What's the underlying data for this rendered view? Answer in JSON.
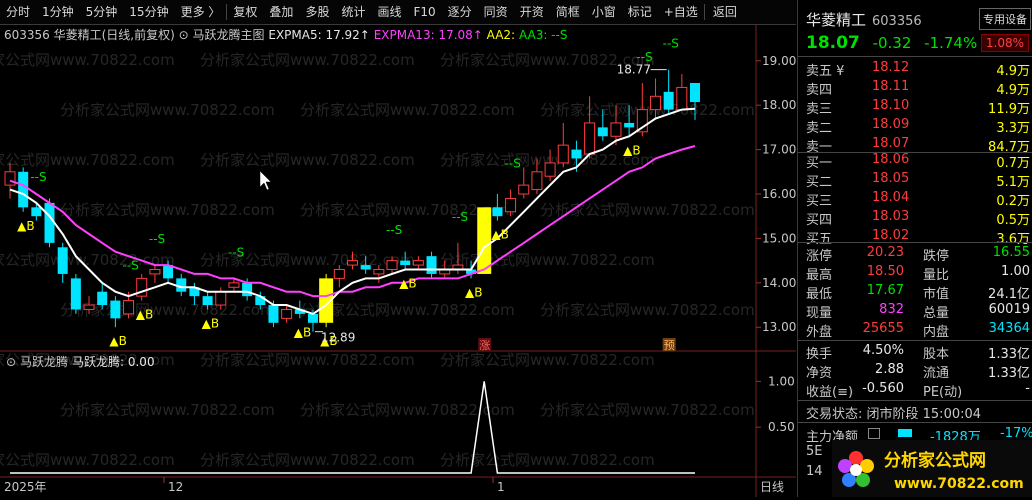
{
  "toolbar": {
    "items": [
      "分时",
      "1分钟",
      "5分钟",
      "15分钟",
      "更多 〉",
      "复权",
      "叠加",
      "多股",
      "统计",
      "画线",
      "F10",
      "逐分",
      "同资",
      "开资",
      "简框",
      "小窗",
      "标记",
      "+自选",
      "返回"
    ]
  },
  "main_chart": {
    "title": "603356 华菱精工(日线,前复权)",
    "indicator_name": "马跃龙腾主图",
    "expma5_label": "EXPMA5: 17.92↑",
    "expma13_label": "EXPMA13: 17.08↑",
    "aa2_label": "AA2:",
    "aa3_label": "AA3: --S",
    "y_axis_labels": [
      "19.00",
      "18.00",
      "17.00",
      "16.00",
      "15.00",
      "14.00",
      "13.00"
    ],
    "high_label": "18.77",
    "low_label": "12.89",
    "b_marker": "▲B",
    "s_marker": "--S",
    "event_zhang": "涨",
    "event_yu": "预",
    "x_axis_labels": [
      "2025年",
      "12",
      "1",
      "日线"
    ],
    "watermark": "分析家公式网www.70822.com",
    "colors": {
      "up": "#ff3c3c",
      "down": "#00e5ff",
      "expma5": "#ffffff",
      "expma13": "#ff40ff",
      "signal": "#ffff00",
      "sell": "#00e000"
    }
  },
  "sub_chart": {
    "title": "马跃龙腾",
    "value_label": "马跃龙腾: 0.00",
    "y_axis_labels": [
      "1.00",
      "0.50"
    ]
  },
  "chart_data": {
    "type": "candlestick",
    "ylim": [
      12.6,
      19.4
    ],
    "candles": [
      {
        "o": 16.2,
        "c": 16.5,
        "h": 16.7,
        "l": 15.9
      },
      {
        "o": 16.5,
        "c": 15.7,
        "h": 16.6,
        "l": 15.6
      },
      {
        "o": 15.7,
        "c": 15.5,
        "h": 15.8,
        "l": 15.4
      },
      {
        "o": 15.8,
        "c": 14.9,
        "h": 15.9,
        "l": 14.8
      },
      {
        "o": 14.8,
        "c": 14.2,
        "h": 14.9,
        "l": 14.0
      },
      {
        "o": 14.1,
        "c": 13.4,
        "h": 14.2,
        "l": 13.3
      },
      {
        "o": 13.4,
        "c": 13.5,
        "h": 13.7,
        "l": 13.3
      },
      {
        "o": 13.8,
        "c": 13.5,
        "h": 14.0,
        "l": 13.4
      },
      {
        "o": 13.6,
        "c": 13.2,
        "h": 13.7,
        "l": 13.0
      },
      {
        "o": 13.3,
        "c": 13.6,
        "h": 13.8,
        "l": 13.2
      },
      {
        "o": 13.7,
        "c": 14.1,
        "h": 14.2,
        "l": 13.6
      },
      {
        "o": 14.2,
        "c": 14.3,
        "h": 14.4,
        "l": 14.0
      },
      {
        "o": 14.4,
        "c": 14.1,
        "h": 14.5,
        "l": 14.0
      },
      {
        "o": 14.1,
        "c": 13.8,
        "h": 14.2,
        "l": 13.7
      },
      {
        "o": 13.9,
        "c": 13.7,
        "h": 14.0,
        "l": 13.5
      },
      {
        "o": 13.7,
        "c": 13.5,
        "h": 13.8,
        "l": 13.4
      },
      {
        "o": 13.5,
        "c": 13.8,
        "h": 13.9,
        "l": 13.4
      },
      {
        "o": 13.9,
        "c": 14.0,
        "h": 14.1,
        "l": 13.8
      },
      {
        "o": 14.0,
        "c": 13.7,
        "h": 14.1,
        "l": 13.6
      },
      {
        "o": 13.7,
        "c": 13.5,
        "h": 13.8,
        "l": 13.4
      },
      {
        "o": 13.5,
        "c": 13.1,
        "h": 13.6,
        "l": 13.0
      },
      {
        "o": 13.2,
        "c": 13.4,
        "h": 13.5,
        "l": 13.1
      },
      {
        "o": 13.4,
        "c": 13.3,
        "h": 13.6,
        "l": 13.2
      },
      {
        "o": 13.3,
        "c": 13.1,
        "h": 13.4,
        "l": 12.9
      },
      {
        "o": 13.1,
        "c": 14.1,
        "h": 14.2,
        "l": 13.0
      },
      {
        "o": 14.1,
        "c": 14.3,
        "h": 14.4,
        "l": 13.9
      },
      {
        "o": 14.4,
        "c": 14.5,
        "h": 14.7,
        "l": 14.3
      },
      {
        "o": 14.4,
        "c": 14.3,
        "h": 14.6,
        "l": 14.2
      },
      {
        "o": 14.2,
        "c": 14.3,
        "h": 14.4,
        "l": 14.0
      },
      {
        "o": 14.3,
        "c": 14.5,
        "h": 14.6,
        "l": 14.2
      },
      {
        "o": 14.5,
        "c": 14.4,
        "h": 14.7,
        "l": 14.3
      },
      {
        "o": 14.4,
        "c": 14.5,
        "h": 14.6,
        "l": 14.3
      },
      {
        "o": 14.6,
        "c": 14.2,
        "h": 14.7,
        "l": 14.1
      },
      {
        "o": 14.2,
        "c": 14.3,
        "h": 14.5,
        "l": 14.1
      },
      {
        "o": 14.3,
        "c": 14.4,
        "h": 14.9,
        "l": 14.2
      },
      {
        "o": 14.3,
        "c": 14.2,
        "h": 14.5,
        "l": 14.1
      },
      {
        "o": 14.2,
        "c": 15.7,
        "h": 15.7,
        "l": 14.2
      },
      {
        "o": 15.7,
        "c": 15.5,
        "h": 16.0,
        "l": 15.4
      },
      {
        "o": 15.6,
        "c": 15.9,
        "h": 16.1,
        "l": 15.5
      },
      {
        "o": 16.0,
        "c": 16.2,
        "h": 16.6,
        "l": 15.9
      },
      {
        "o": 16.1,
        "c": 16.5,
        "h": 16.8,
        "l": 16.0
      },
      {
        "o": 16.4,
        "c": 16.7,
        "h": 17.0,
        "l": 16.3
      },
      {
        "o": 16.7,
        "c": 17.1,
        "h": 17.6,
        "l": 16.6
      },
      {
        "o": 17.0,
        "c": 16.8,
        "h": 17.2,
        "l": 16.5
      },
      {
        "o": 16.9,
        "c": 17.6,
        "h": 18.2,
        "l": 16.8
      },
      {
        "o": 17.5,
        "c": 17.3,
        "h": 17.9,
        "l": 17.2
      },
      {
        "o": 17.3,
        "c": 17.6,
        "h": 18.0,
        "l": 17.1
      },
      {
        "o": 17.6,
        "c": 17.5,
        "h": 18.0,
        "l": 17.3
      },
      {
        "o": 17.4,
        "c": 17.9,
        "h": 18.5,
        "l": 17.3
      },
      {
        "o": 17.9,
        "c": 18.2,
        "h": 18.6,
        "l": 17.7
      },
      {
        "o": 18.3,
        "c": 17.9,
        "h": 18.8,
        "l": 17.8
      },
      {
        "o": 17.9,
        "c": 18.4,
        "h": 18.7,
        "l": 17.9
      },
      {
        "o": 18.5,
        "c": 18.07,
        "h": 18.5,
        "l": 17.67
      }
    ],
    "limit_up_indices": [
      24,
      36
    ],
    "expma5": [
      16.1,
      16.0,
      15.8,
      15.5,
      15.1,
      14.6,
      14.3,
      14.0,
      13.8,
      13.7,
      13.8,
      13.9,
      14.0,
      13.9,
      13.9,
      13.8,
      13.8,
      13.8,
      13.8,
      13.7,
      13.5,
      13.5,
      13.4,
      13.3,
      13.5,
      13.8,
      14.0,
      14.1,
      14.1,
      14.2,
      14.3,
      14.3,
      14.3,
      14.3,
      14.3,
      14.3,
      14.8,
      15.0,
      15.3,
      15.6,
      15.9,
      16.2,
      16.5,
      16.6,
      16.9,
      17.0,
      17.2,
      17.3,
      17.5,
      17.7,
      17.8,
      17.9,
      17.92
    ],
    "expma13": [
      16.3,
      16.2,
      16.0,
      15.8,
      15.6,
      15.3,
      15.1,
      14.9,
      14.7,
      14.6,
      14.5,
      14.4,
      14.4,
      14.3,
      14.2,
      14.2,
      14.1,
      14.1,
      14.0,
      14.0,
      13.9,
      13.8,
      13.8,
      13.7,
      13.7,
      13.8,
      13.8,
      13.9,
      13.9,
      14.0,
      14.0,
      14.1,
      14.1,
      14.1,
      14.1,
      14.2,
      14.3,
      14.5,
      14.7,
      14.9,
      15.1,
      15.3,
      15.5,
      15.7,
      15.9,
      16.1,
      16.3,
      16.5,
      16.6,
      16.8,
      16.9,
      17.0,
      17.08
    ],
    "buy_indices": [
      1,
      8,
      10,
      15,
      22,
      24,
      30,
      35,
      37,
      47
    ],
    "sell_indices": [
      2,
      9,
      11,
      17,
      29,
      34,
      38,
      48,
      50
    ],
    "sub_values": [
      0,
      0,
      0,
      0,
      0,
      0,
      0,
      0,
      0,
      0,
      0,
      0,
      0,
      0,
      0,
      0,
      0,
      0,
      0,
      0,
      0,
      0,
      0,
      0,
      0,
      0,
      0,
      0,
      0,
      0,
      0,
      0,
      0,
      0,
      0,
      0,
      1,
      0,
      0,
      0,
      0,
      0,
      0,
      0,
      0,
      0,
      0,
      0,
      0,
      0,
      0,
      0,
      0
    ],
    "sub_ylim": [
      0,
      1.2
    ]
  },
  "panel": {
    "name": "华菱精工",
    "code": "603356",
    "device_btn": "专用设备",
    "price": "18.07",
    "change": "-0.32",
    "change_pct": "-1.74%",
    "ratio": "1.08%",
    "asks": [
      {
        "label": "卖五 ¥",
        "price": "18.12",
        "vol": "4.9万"
      },
      {
        "label": "卖四",
        "price": "18.11",
        "vol": "4.9万"
      },
      {
        "label": "卖三",
        "price": "18.10",
        "vol": "11.9万"
      },
      {
        "label": "卖二",
        "price": "18.09",
        "vol": "3.3万"
      },
      {
        "label": "卖一",
        "price": "18.07",
        "vol": "84.7万"
      }
    ],
    "bids": [
      {
        "label": "买一",
        "price": "18.06",
        "vol": "0.7万"
      },
      {
        "label": "买二",
        "price": "18.05",
        "vol": "5.1万"
      },
      {
        "label": "买三",
        "price": "18.04",
        "vol": "0.2万"
      },
      {
        "label": "买四",
        "price": "18.03",
        "vol": "0.5万"
      },
      {
        "label": "买五",
        "price": "18.02",
        "vol": "3.6万"
      }
    ],
    "stats": [
      {
        "l1": "涨停",
        "v1": "20.23",
        "c1": "red",
        "l2": "跌停",
        "v2": "16.55",
        "c2": "green"
      },
      {
        "l1": "最高",
        "v1": "18.50",
        "c1": "red",
        "l2": "量比",
        "v2": "1.00",
        "c2": "white"
      },
      {
        "l1": "最低",
        "v1": "17.67",
        "c1": "green",
        "l2": "市值",
        "v2": "24.1亿",
        "c2": "white"
      },
      {
        "l1": "现量",
        "v1": "832",
        "c1": "magenta",
        "l2": "总量",
        "v2": "60019",
        "c2": "white"
      },
      {
        "l1": "外盘",
        "v1": "25655",
        "c1": "red",
        "l2": "内盘",
        "v2": "34364",
        "c2": "cyan"
      }
    ],
    "stats2": [
      {
        "l1": "换手",
        "v1": "4.50%",
        "l2": "股本",
        "v2": "1.33亿"
      },
      {
        "l1": "净资",
        "v1": "2.88",
        "l2": "流通",
        "v2": "1.33亿"
      },
      {
        "l1": "收益(≡)",
        "v1": "-0.560",
        "l2": "PE(动)",
        "v2": "-"
      }
    ],
    "trade_status": "交易状态: 闭市阶段 15:00:04",
    "main_flow_label": "主力净额",
    "main_flow_value": "-1828万",
    "main_flow_pct": "-17%",
    "row_5e": "5E",
    "row_14": "14",
    "logo_text": "分析家公式网",
    "logo_url": "www.70822.com"
  }
}
